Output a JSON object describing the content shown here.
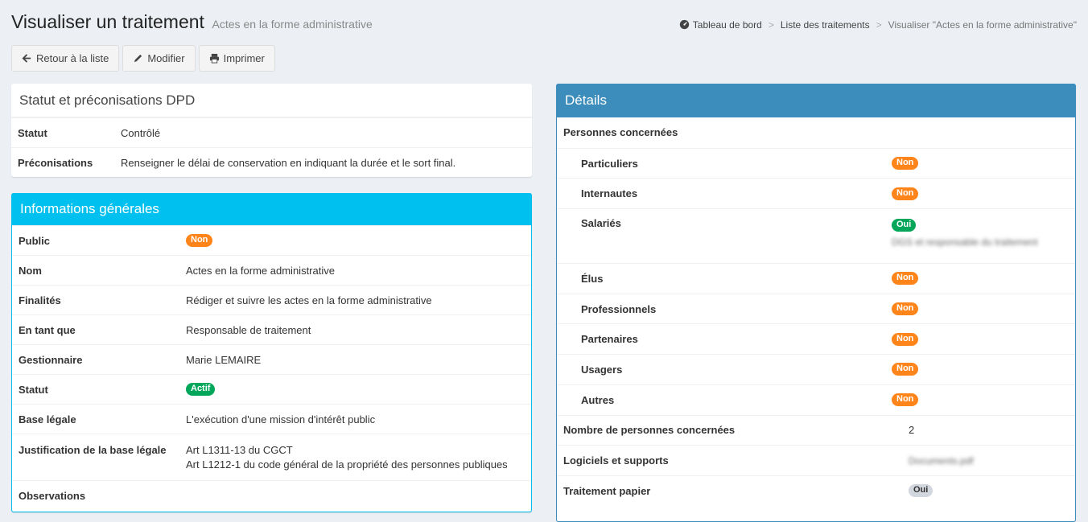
{
  "header": {
    "title": "Visualiser un traitement",
    "subtitle": "Actes en la forme administrative"
  },
  "breadcrumb": {
    "home": "Tableau de bord",
    "list": "Liste des traitements",
    "current": "Visualiser \"Actes en la forme administrative\""
  },
  "toolbar": {
    "back": "Retour à la liste",
    "edit": "Modifier",
    "print": "Imprimer"
  },
  "statut_box": {
    "title": "Statut et préconisations DPD",
    "rows": [
      {
        "label": "Statut",
        "value": "Contrôlé"
      },
      {
        "label": "Préconisations",
        "value": "Renseigner le délai de conservation en indiquant la durée et le sort final."
      }
    ]
  },
  "info_box": {
    "title": "Informations générales",
    "public_label": "Public",
    "public_badge": "Non",
    "nom_label": "Nom",
    "nom_value": "Actes en la forme administrative",
    "finalites_label": "Finalités",
    "finalites_value": "Rédiger et suivre les actes en la forme administrative",
    "entantque_label": "En tant que",
    "entantque_value": "Responsable de traitement",
    "gestionnaire_label": "Gestionnaire",
    "gestionnaire_value": "Marie LEMAIRE",
    "statut_label": "Statut",
    "statut_badge": "Actif",
    "base_label": "Base légale",
    "base_value": "L'exécution d'une mission d'intérêt public",
    "justif_label": "Justification de la base légale",
    "justif_line1": "Art L1311-13 du CGCT",
    "justif_line2": "Art L1212-1 du code général de la propriété des personnes publiques",
    "obs_label": "Observations"
  },
  "details_box": {
    "title": "Détails",
    "personnes_label": "Personnes concernées",
    "particuliers_label": "Particuliers",
    "particuliers_badge": "Non",
    "internautes_label": "Internautes",
    "internautes_badge": "Non",
    "salaries_label": "Salariés",
    "salaries_badge": "Oui",
    "salaries_note": "DGS et responsable du traitement",
    "elus_label": "Élus",
    "elus_badge": "Non",
    "professionnels_label": "Professionnels",
    "professionnels_badge": "Non",
    "partenaires_label": "Partenaires",
    "partenaires_badge": "Non",
    "usagers_label": "Usagers",
    "usagers_badge": "Non",
    "autres_label": "Autres",
    "autres_badge": "Non",
    "nombre_label": "Nombre de personnes concernées",
    "nombre_value": "2",
    "logiciels_label": "Logiciels et supports",
    "logiciels_value": "Documents.pdf",
    "papier_label": "Traitement papier",
    "papier_badge": "Oui"
  },
  "colors": {
    "info_accent": "#00c0ef",
    "details_accent": "#3c8dbc",
    "badge_non": "#ff851b",
    "badge_oui": "#00a65a",
    "badge_neutral": "#d2d6de"
  }
}
